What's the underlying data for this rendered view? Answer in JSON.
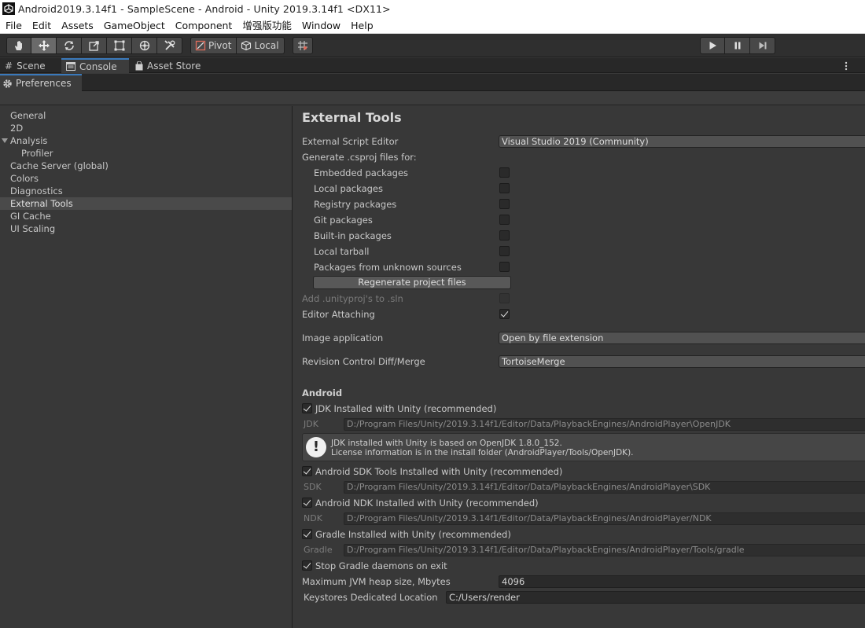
{
  "window": {
    "title": "Android2019.3.14f1 - SampleScene - Android - Unity 2019.3.14f1 <DX11>"
  },
  "menu": [
    "File",
    "Edit",
    "Assets",
    "GameObject",
    "Component",
    "增强版功能",
    "Window",
    "Help"
  ],
  "toolbar": {
    "pivot_label": "Pivot",
    "local_label": "Local"
  },
  "tabs": {
    "scene": "Scene",
    "console": "Console",
    "asset_store": "Asset Store"
  },
  "preferences_tab": "Preferences",
  "sidebar": {
    "items": [
      "General",
      "2D",
      "Analysis",
      "Profiler",
      "Cache Server (global)",
      "Colors",
      "Diagnostics",
      "External Tools",
      "GI Cache",
      "UI Scaling"
    ],
    "selected": "External Tools"
  },
  "external_tools": {
    "title": "External Tools",
    "script_editor_label": "External Script Editor",
    "script_editor_value": "Visual Studio 2019 (Community)",
    "csproj_label": "Generate .csproj files for:",
    "packages": [
      {
        "label": "Embedded packages",
        "checked": false
      },
      {
        "label": "Local packages",
        "checked": false
      },
      {
        "label": "Registry packages",
        "checked": false
      },
      {
        "label": "Git packages",
        "checked": false
      },
      {
        "label": "Built-in packages",
        "checked": false
      },
      {
        "label": "Local tarball",
        "checked": false
      },
      {
        "label": "Packages from unknown sources",
        "checked": false
      }
    ],
    "regenerate_label": "Regenerate project files",
    "unityproj_label": "Add .unityproj's to .sln",
    "editor_attaching_label": "Editor Attaching",
    "editor_attaching_checked": true,
    "image_app_label": "Image application",
    "image_app_value": "Open by file extension",
    "revision_label": "Revision Control Diff/Merge",
    "revision_value": "TortoiseMerge"
  },
  "android": {
    "title": "Android",
    "jdk_toggle": "JDK Installed with Unity (recommended)",
    "jdk_label": "JDK",
    "jdk_path": "D:/Program Files/Unity/2019.3.14f1/Editor/Data/PlaybackEngines/AndroidPlayer\\OpenJDK",
    "jdk_info_line1": "JDK installed with Unity is based on OpenJDK 1.8.0_152.",
    "jdk_info_line2": "License information is in the install folder (AndroidPlayer/Tools/OpenJDK).",
    "sdk_toggle": "Android SDK Tools Installed with Unity (recommended)",
    "sdk_label": "SDK",
    "sdk_path": "D:/Program Files/Unity/2019.3.14f1/Editor/Data/PlaybackEngines/AndroidPlayer\\SDK",
    "ndk_toggle": "Android NDK Installed with Unity (recommended)",
    "ndk_label": "NDK",
    "ndk_path": "D:/Program Files/Unity/2019.3.14f1/Editor/Data/PlaybackEngines/AndroidPlayer/NDK",
    "gradle_toggle": "Gradle Installed with Unity (recommended)",
    "gradle_label": "Gradle",
    "gradle_path": "D:/Program Files/Unity/2019.3.14f1/Editor/Data/PlaybackEngines/AndroidPlayer/Tools/gradle",
    "stop_gradle_label": "Stop Gradle daemons on exit",
    "jvm_label": "Maximum JVM heap size, Mbytes",
    "jvm_value": "4096",
    "keystores_label": "Keystores Dedicated Location",
    "keystores_value": "C:/Users/render"
  }
}
